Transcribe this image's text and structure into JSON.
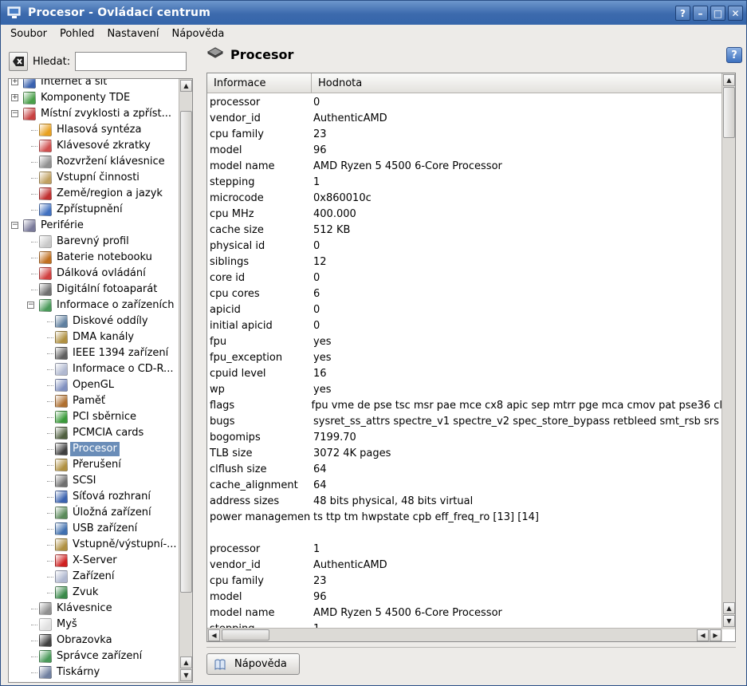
{
  "window": {
    "title": "Procesor - Ovládací centrum"
  },
  "titlebar_buttons": [
    "?",
    "–",
    "□",
    "✕"
  ],
  "menu": [
    "Soubor",
    "Pohled",
    "Nastavení",
    "Nápověda"
  ],
  "search": {
    "label": "Hledat:",
    "value": ""
  },
  "tree": [
    {
      "label": "Internet a síť",
      "level": 0,
      "expander": "+",
      "icon": "network-icon",
      "color": "#3a62b0"
    },
    {
      "label": "Komponenty TDE",
      "level": 0,
      "expander": "+",
      "icon": "components-icon",
      "color": "#4aa04a"
    },
    {
      "label": "Místní zvyklosti a zpříst...",
      "level": 0,
      "expander": "−",
      "icon": "locale-icon",
      "color": "#c84040"
    },
    {
      "label": "Hlasová syntéza",
      "level": 1,
      "icon": "speech-icon",
      "color": "#e8a020"
    },
    {
      "label": "Klávesové zkratky",
      "level": 1,
      "icon": "shortcuts-icon",
      "color": "#d05050"
    },
    {
      "label": "Rozvržení klávesnice",
      "level": 1,
      "icon": "keyboard-layout-icon",
      "color": "#909090"
    },
    {
      "label": "Vstupní činnosti",
      "level": 1,
      "icon": "input-actions-icon",
      "color": "#c0a060"
    },
    {
      "label": "Země/region a jazyk",
      "level": 1,
      "icon": "flag-icon",
      "color": "#c03030"
    },
    {
      "label": "Zpřístupnění",
      "level": 1,
      "icon": "accessibility-icon",
      "color": "#4070c0"
    },
    {
      "label": "Periférie",
      "level": 0,
      "expander": "−",
      "icon": "peripherals-icon",
      "color": "#7a7a9a"
    },
    {
      "label": "Barevný profil",
      "level": 1,
      "icon": "color-profile-icon",
      "color": "#c8c8c8"
    },
    {
      "label": "Baterie notebooku",
      "level": 1,
      "icon": "battery-icon",
      "color": "#c07020"
    },
    {
      "label": "Dálková ovládání",
      "level": 1,
      "icon": "remote-icon",
      "color": "#d04040"
    },
    {
      "label": "Digitální fotoaparát",
      "level": 1,
      "icon": "camera-icon",
      "color": "#707070"
    },
    {
      "label": "Informace o zařízeních",
      "level": 1,
      "expander": "−",
      "icon": "device-info-icon",
      "color": "#4a9a5a"
    },
    {
      "label": "Diskové oddíly",
      "level": 2,
      "icon": "partitions-icon",
      "color": "#6080a0"
    },
    {
      "label": "DMA kanály",
      "level": 2,
      "icon": "dma-icon",
      "color": "#b09040"
    },
    {
      "label": "IEEE 1394 zařízení",
      "level": 2,
      "icon": "ieee1394-icon",
      "color": "#606060"
    },
    {
      "label": "Informace o CD-R...",
      "level": 2,
      "icon": "cdrom-icon",
      "color": "#b0b8d0"
    },
    {
      "label": "OpenGL",
      "level": 2,
      "icon": "opengl-icon",
      "color": "#8090c0"
    },
    {
      "label": "Paměť",
      "level": 2,
      "icon": "memory-icon",
      "color": "#b07030"
    },
    {
      "label": "PCI sběrnice",
      "level": 2,
      "icon": "pci-icon",
      "color": "#3a9a3a"
    },
    {
      "label": "PCMCIA cards",
      "level": 2,
      "icon": "pcmcia-icon",
      "color": "#506040"
    },
    {
      "label": "Procesor",
      "level": 2,
      "icon": "processor-icon",
      "color": "#404040",
      "selected": true
    },
    {
      "label": "Přerušení",
      "level": 2,
      "icon": "interrupts-icon",
      "color": "#b09040"
    },
    {
      "label": "SCSI",
      "level": 2,
      "icon": "scsi-icon",
      "color": "#707070"
    },
    {
      "label": "Síťová rozhraní",
      "level": 2,
      "icon": "network-interfaces-icon",
      "color": "#3a62b0"
    },
    {
      "label": "Úložná zařízení",
      "level": 2,
      "icon": "storage-icon",
      "color": "#5a8a5a"
    },
    {
      "label": "USB zařízení",
      "level": 2,
      "icon": "usb-icon",
      "color": "#4070b0"
    },
    {
      "label": "Vstupně/výstupní-...",
      "level": 2,
      "icon": "io-ports-icon",
      "color": "#b09040"
    },
    {
      "label": "X-Server",
      "level": 2,
      "icon": "xserver-icon",
      "color": "#d02020"
    },
    {
      "label": "Zařízení",
      "level": 2,
      "icon": "devices-icon",
      "color": "#b0b8d0"
    },
    {
      "label": "Zvuk",
      "level": 2,
      "icon": "sound-icon",
      "color": "#3a8a4a"
    },
    {
      "label": "Klávesnice",
      "level": 1,
      "icon": "keyboard-icon",
      "color": "#909090"
    },
    {
      "label": "Myš",
      "level": 1,
      "icon": "mouse-icon",
      "color": "#e0e0e0"
    },
    {
      "label": "Obrazovka",
      "level": 1,
      "icon": "display-icon",
      "color": "#404040"
    },
    {
      "label": "Správce zařízení",
      "level": 1,
      "icon": "device-manager-icon",
      "color": "#4a9a5a"
    },
    {
      "label": "Tiskárny",
      "level": 1,
      "icon": "printer-icon",
      "color": "#7080a0"
    }
  ],
  "page": {
    "title": "Procesor"
  },
  "table": {
    "columns": [
      "Informace",
      "Hodnota"
    ],
    "rows": [
      [
        "processor",
        "0"
      ],
      [
        "vendor_id",
        "AuthenticAMD"
      ],
      [
        "cpu family",
        "23"
      ],
      [
        "model",
        "96"
      ],
      [
        "model name",
        "AMD Ryzen 5 4500 6-Core Processor"
      ],
      [
        "stepping",
        "1"
      ],
      [
        "microcode",
        "0x860010c"
      ],
      [
        "cpu MHz",
        "400.000"
      ],
      [
        "cache size",
        "512 KB"
      ],
      [
        "physical id",
        "0"
      ],
      [
        "siblings",
        "12"
      ],
      [
        "core id",
        "0"
      ],
      [
        "cpu cores",
        "6"
      ],
      [
        "apicid",
        "0"
      ],
      [
        "initial apicid",
        "0"
      ],
      [
        "fpu",
        "yes"
      ],
      [
        "fpu_exception",
        "yes"
      ],
      [
        "cpuid level",
        "16"
      ],
      [
        "wp",
        "yes"
      ],
      [
        "flags",
        "fpu vme de pse tsc msr pae mce cx8 apic sep mtrr pge mca cmov pat pse36 cl"
      ],
      [
        "bugs",
        "sysret_ss_attrs spectre_v1 spectre_v2 spec_store_bypass retbleed smt_rsb srs"
      ],
      [
        "bogomips",
        "7199.70"
      ],
      [
        "TLB size",
        "3072 4K pages"
      ],
      [
        "clflush size",
        "64"
      ],
      [
        "cache_alignment",
        "64"
      ],
      [
        "address sizes",
        "48 bits physical, 48 bits virtual"
      ],
      [
        "power managemen",
        "ts ttp tm hwpstate cpb eff_freq_ro [13] [14]"
      ],
      [
        "",
        ""
      ],
      [
        "processor",
        "1"
      ],
      [
        "vendor_id",
        "AuthenticAMD"
      ],
      [
        "cpu family",
        "23"
      ],
      [
        "model",
        "96"
      ],
      [
        "model name",
        "AMD Ryzen 5 4500 6-Core Processor"
      ],
      [
        "stepping",
        "1"
      ]
    ]
  },
  "help_button": {
    "label": "Nápověda"
  },
  "colors": {
    "titlebar": "#3c6aad",
    "selection": "#6a8db8"
  }
}
